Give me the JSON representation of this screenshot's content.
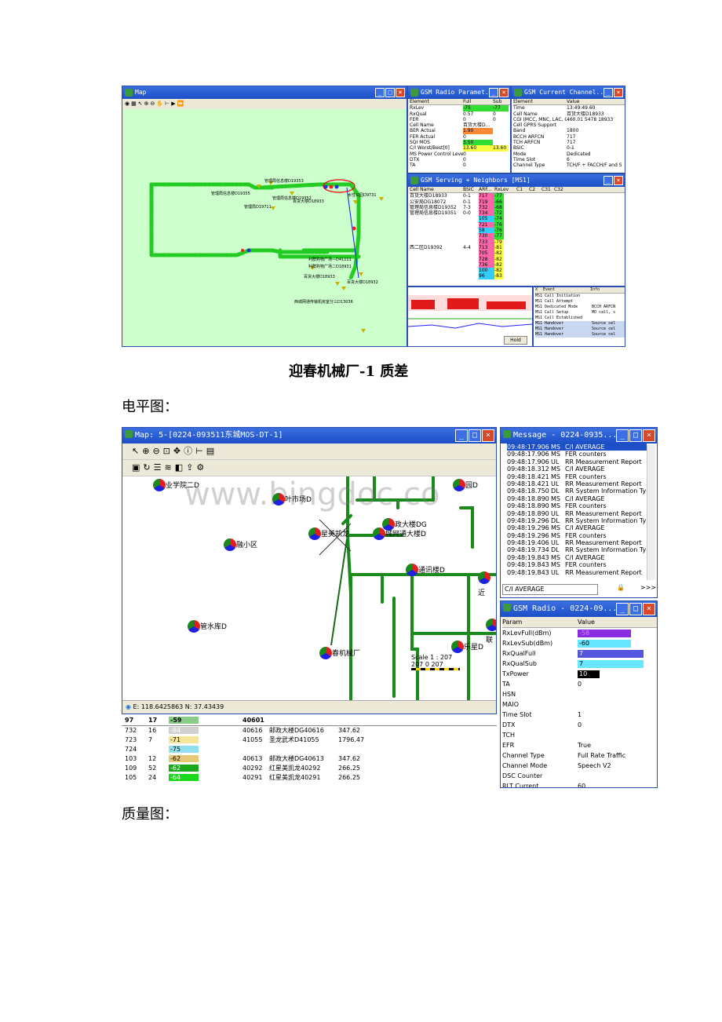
{
  "shot1": {
    "map": {
      "title": "Map",
      "labels": [
        "管理局信息楼D19353",
        "管理局信息楼D19355",
        "管理局信息楼D19352",
        "管理局D19711",
        "百货大楼D18933",
        "水性公园D9731",
        "利群购物广场—D41111",
        "利群购物广场二D18931",
        "百货大楼D18933",
        "百货大楼D18932",
        "西城网通传输机房室分三D13036"
      ]
    },
    "radio": {
      "title": "GSM Radio Paramet...",
      "headers": [
        "Element",
        "Full",
        "Sub"
      ],
      "rows": [
        [
          "RxLev",
          "-75",
          "-77"
        ],
        [
          "RxQual",
          "0.57",
          "0"
        ],
        [
          "FER",
          "0",
          "0"
        ],
        [
          "Cell Name",
          "百货大楼D...",
          ""
        ],
        [
          "BER Actual",
          "1.90",
          ""
        ],
        [
          "FER Actual",
          "0",
          ""
        ],
        [
          "SQI MOS",
          "3.50",
          ""
        ],
        [
          "C/I Worst/Best[0]",
          "13.60",
          "13.60"
        ],
        [
          "MS Power Control Level",
          "0",
          ""
        ],
        [
          "DTX",
          "0",
          ""
        ],
        [
          "TA",
          "0",
          ""
        ]
      ]
    },
    "channel": {
      "title": "GSM Current Channel...",
      "headers": [
        "Element",
        "Value"
      ],
      "rows": [
        [
          "Time",
          "13:49:49.60"
        ],
        [
          "Cell Name",
          "百货大楼D18933"
        ],
        [
          "CGI (MCC, MNC, LAC, CI)",
          "460.01 5478 18933"
        ],
        [
          "Cell GPRS Support",
          ""
        ],
        [
          "Band",
          "1800"
        ],
        [
          "BCCH ARFCN",
          "717"
        ],
        [
          "TCH ARFCN",
          "717"
        ],
        [
          "BSIC",
          "0-1"
        ],
        [
          "Mode",
          "Dedicated"
        ],
        [
          "Time Slot",
          "6"
        ],
        [
          "Channel Type",
          "TCH/F + FACCH/F and S."
        ]
      ]
    },
    "neighbors": {
      "title": "GSM Serving + Neighbors [MS1]",
      "headers": [
        "Cell Name",
        "BSIC",
        "ARF...",
        "RxLev",
        "C1",
        "C2",
        "C31",
        "C32"
      ],
      "rows": [
        [
          "百货大楼D18933",
          "0-1",
          "717",
          "-77"
        ],
        [
          "公安局DG18072",
          "0-1",
          "719",
          "-66"
        ],
        [
          "管理局信息楼D19352",
          "7-3",
          "732",
          "-68"
        ],
        [
          "管理局信息楼D19351",
          "0-0",
          "734",
          "-72"
        ],
        [
          "",
          "",
          "105",
          "-74"
        ],
        [
          "",
          "",
          "721",
          "-76"
        ],
        [
          "",
          "",
          "58",
          "-76"
        ],
        [
          "",
          "",
          "730",
          "-77"
        ],
        [
          "",
          "",
          "733",
          "-79"
        ],
        [
          "西二区D19392",
          "4-4",
          "713",
          "-81"
        ],
        [
          "",
          "",
          "705",
          "-82"
        ],
        [
          "",
          "",
          "728",
          "-82"
        ],
        [
          "",
          "",
          "736",
          "-82"
        ],
        [
          "",
          "",
          "100",
          "-82"
        ],
        [
          "",
          "",
          "96",
          "-83"
        ]
      ]
    },
    "events": {
      "headers": [
        "Event",
        "Info"
      ],
      "rows": [
        [
          "MS1",
          "Call Initiation",
          ""
        ],
        [
          "MS1",
          "Call Attempt",
          ""
        ],
        [
          "MS1",
          "Dedicated Mode",
          "BCCH ARFCN"
        ],
        [
          "MS1",
          "Call Setup",
          "MO call, s"
        ],
        [
          "MS1",
          "Call Established",
          ""
        ],
        [
          "MS1",
          "Handover",
          "Source cel"
        ],
        [
          "MS1",
          "Handover",
          "Source cel"
        ],
        [
          "MS1",
          "Handover",
          "Source cel"
        ]
      ]
    },
    "hold": "Hold"
  },
  "caption1": "迎春机械厂-1 质差",
  "heading_level": "电平图：",
  "shot2": {
    "map": {
      "title": "Map: 5-[0224-093511东城MOS-DT-1]",
      "watermark": "www.bingdoc.co",
      "sites": [
        "业学院二D",
        "叶市场D",
        "政大楼DG",
        "城网通大楼D",
        "星美凯龙",
        "融小区",
        "通讯楼D",
        "管水库D",
        "春机械厂",
        "乐星D",
        "园D",
        "联",
        "近"
      ],
      "scale": "Scale 1 : 207",
      "scale_ticks": "207  0    207",
      "coords": "E: 118.6425863 N: 37.43439"
    },
    "table": {
      "rows": [
        [
          "97",
          "17",
          "-59",
          "40601",
          "",
          ""
        ],
        [
          "732",
          "16",
          "-84",
          "40616",
          "邮政大楼DG40616",
          "347.62"
        ],
        [
          "723",
          "7",
          "-71",
          "41055",
          "圣龙武术D41055",
          "1796.47"
        ],
        [
          "724",
          "",
          "-75",
          "",
          "",
          ""
        ],
        [
          "103",
          "12",
          "-62",
          "40613",
          "邮政大楼DG40613",
          "347.62"
        ],
        [
          "109",
          "52",
          "-62",
          "40292",
          "红星美凯龙40292",
          "266.25"
        ],
        [
          "105",
          "24",
          "-64",
          "40291",
          "红星美凯龙40291",
          "266.25"
        ]
      ]
    },
    "message": {
      "title": "Message - 0224-0935...",
      "rows": [
        [
          "09:48:17.906",
          "MS",
          "C/I AVERAGE"
        ],
        [
          "09:48:17.906",
          "MS",
          "FER counters"
        ],
        [
          "09:48:17.906",
          "UL",
          "RR Measurement Report"
        ],
        [
          "09:48:18.312",
          "MS",
          "C/I AVERAGE"
        ],
        [
          "09:48:18.421",
          "MS",
          "FER counters"
        ],
        [
          "09:48:18.421",
          "UL",
          "RR Measurement Report"
        ],
        [
          "09:48:18.750",
          "DL",
          "RR System Information Type 5"
        ],
        [
          "09:48:18.890",
          "MS",
          "C/I AVERAGE"
        ],
        [
          "09:48:18.890",
          "MS",
          "FER counters"
        ],
        [
          "09:48:18.890",
          "UL",
          "RR Measurement Report"
        ],
        [
          "09:48:19.296",
          "DL",
          "RR System Information Type 5"
        ],
        [
          "09:48:19.296",
          "MS",
          "C/I AVERAGE"
        ],
        [
          "09:48:19.296",
          "MS",
          "FER counters"
        ],
        [
          "09:48:19.406",
          "UL",
          "RR Measurement Report"
        ],
        [
          "09:48:19.734",
          "DL",
          "RR System Information Type 6"
        ],
        [
          "09:48:19.843",
          "MS",
          "C/I AVERAGE"
        ],
        [
          "09:48:19.843",
          "MS",
          "FER counters"
        ],
        [
          "09:48:19.843",
          "UL",
          "RR Measurement Report"
        ]
      ],
      "filter": "C/I AVERAGE"
    },
    "radio": {
      "title": "GSM Radio - 0224-09...",
      "headers": [
        "Param",
        "Value"
      ],
      "rows": [
        [
          "RxLevFull(dBm)",
          "-58"
        ],
        [
          "RxLevSub(dBm)",
          "-60"
        ],
        [
          "RxQualFull",
          "7"
        ],
        [
          "RxQualSub",
          "7"
        ],
        [
          "TxPower",
          "10"
        ],
        [
          "TA",
          "0"
        ],
        [
          "HSN",
          ""
        ],
        [
          "MAIO",
          ""
        ],
        [
          "Time Slot",
          "1"
        ],
        [
          "DTX",
          "0"
        ],
        [
          "TCH",
          ""
        ],
        [
          "EFR",
          "True"
        ],
        [
          "Channel Type",
          "Full Rate Traffic"
        ],
        [
          "Channel Mode",
          "Speech V2"
        ],
        [
          "DSC Counter",
          ""
        ],
        [
          "RLT Current",
          "60"
        ]
      ]
    }
  },
  "heading_quality": "质量图：",
  "colors": {
    "titlebar": "#1d4fc7",
    "map_bg": "#ccffcc",
    "track_green": "#1aa81a",
    "route_green": "#1a8a1a"
  }
}
